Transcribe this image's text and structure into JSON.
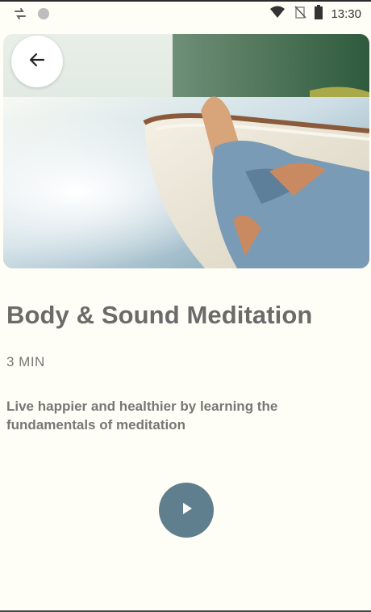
{
  "status_bar": {
    "time": "13:30",
    "icons": [
      "sync-icon",
      "circle-icon",
      "wifi-icon",
      "no-signal-icon",
      "battery-icon"
    ]
  },
  "hero": {
    "icon": "back-arrow-icon"
  },
  "meditation": {
    "title": "Body & Sound Meditation",
    "duration": "3 MIN",
    "description": "Live happier and healthier by learning the fundamentals of meditation"
  },
  "player": {
    "icon": "play-icon"
  },
  "colors": {
    "background": "#fffef6",
    "play_button": "#5f7f8f",
    "title_text": "#6b6b6b"
  }
}
